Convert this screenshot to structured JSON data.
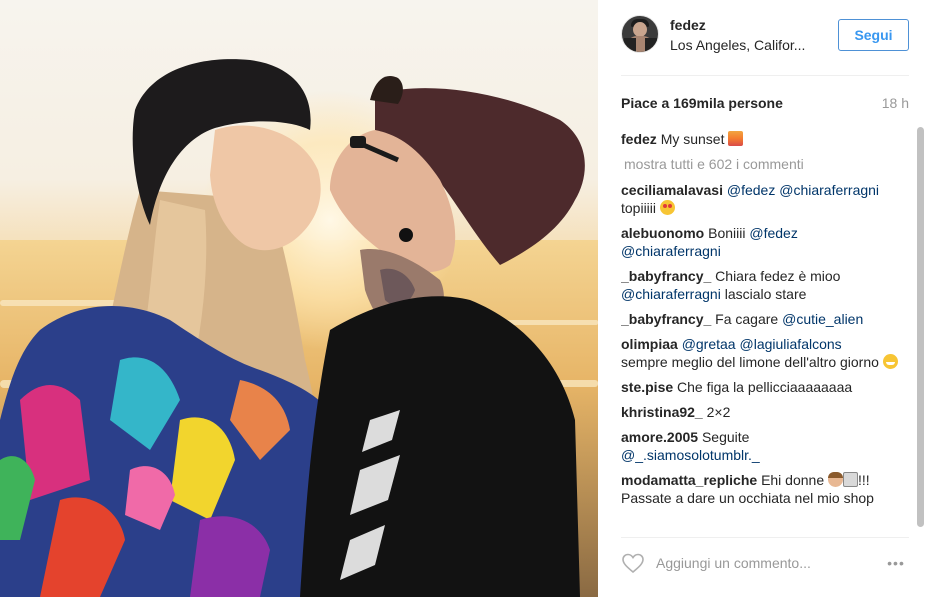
{
  "post": {
    "photo_alt": "Couple kissing at sunset on the beach",
    "header": {
      "username": "fedez",
      "location": "Los Angeles, Califor...",
      "follow_label": "Segui"
    },
    "likes": {
      "prefix": "Piace a ",
      "count": "169mila persone"
    },
    "time_ago": "18 h",
    "caption": {
      "author": "fedez",
      "text": "My sunset",
      "emoji": "sunset-emoji"
    },
    "show_all_comments": "mostra tutti e 602 i commenti",
    "comments": [
      {
        "author": "ceciliamalavasi",
        "mention1": "@fedez",
        "mention2": "@chiaraferragni",
        "text": "topiiiii",
        "emoji": "heart-eyes-emoji"
      },
      {
        "author": "alebuonomo",
        "text": "Boniiii",
        "mention1": "@fedez",
        "mention2": "@chiaraferragni"
      },
      {
        "author": "_babyfrancy_",
        "text": "Chiara fedez è mioo",
        "mention1": "@chiaraferragni",
        "text2": "lascialo stare"
      },
      {
        "author": "_babyfrancy_",
        "text": "Fa cagare",
        "mention1": "@cutie_alien"
      },
      {
        "author": "olimpiaa",
        "mention1": "@gretaa",
        "mention2": "@lagiuliafalcons",
        "text": "sempre meglio del limone dell'altro giorno",
        "emoji": "grinning-emoji"
      },
      {
        "author": "ste.pise",
        "text": "Che figa la pellicciaaaaaaaa"
      },
      {
        "author": "khristina92_",
        "text": "2×2"
      },
      {
        "author": "amore.2005",
        "text": "Seguite",
        "mention1": "@_.siamosolotumblr._"
      },
      {
        "author": "modamatta_repliche",
        "text": "Ehi donne",
        "text2": "!!!",
        "text3": "Passate a dare un occhiata nel mio shop",
        "emoji1": "woman-emoji",
        "emoji2": "camera-emoji"
      }
    ],
    "comment_placeholder": "Aggiungi un commento...",
    "more_label": "•••",
    "colors": {
      "follow_text": "#3897f0",
      "follow_border": "#4e91d6",
      "mention": "#003569",
      "muted": "#999999"
    }
  }
}
